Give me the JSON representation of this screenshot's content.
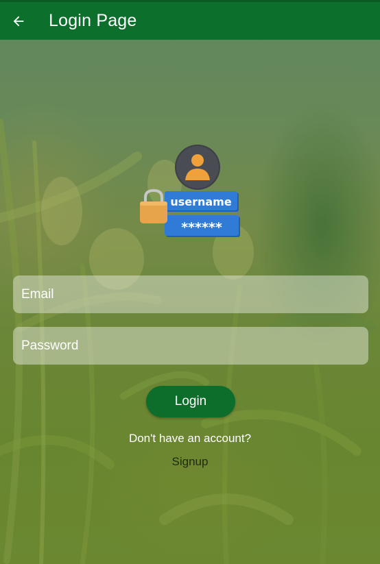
{
  "appbar": {
    "title": "Login Page",
    "back_icon": "arrow-left-icon",
    "color": "#0c6f2c"
  },
  "illustration": {
    "caption": "username",
    "password_mask": "******"
  },
  "form": {
    "email_placeholder": "Email",
    "password_placeholder": "Password"
  },
  "actions": {
    "login_label": "Login",
    "signup_prompt": "Don't have an account?",
    "signup_label": "Signup",
    "button_color": "#0d6e2b"
  }
}
